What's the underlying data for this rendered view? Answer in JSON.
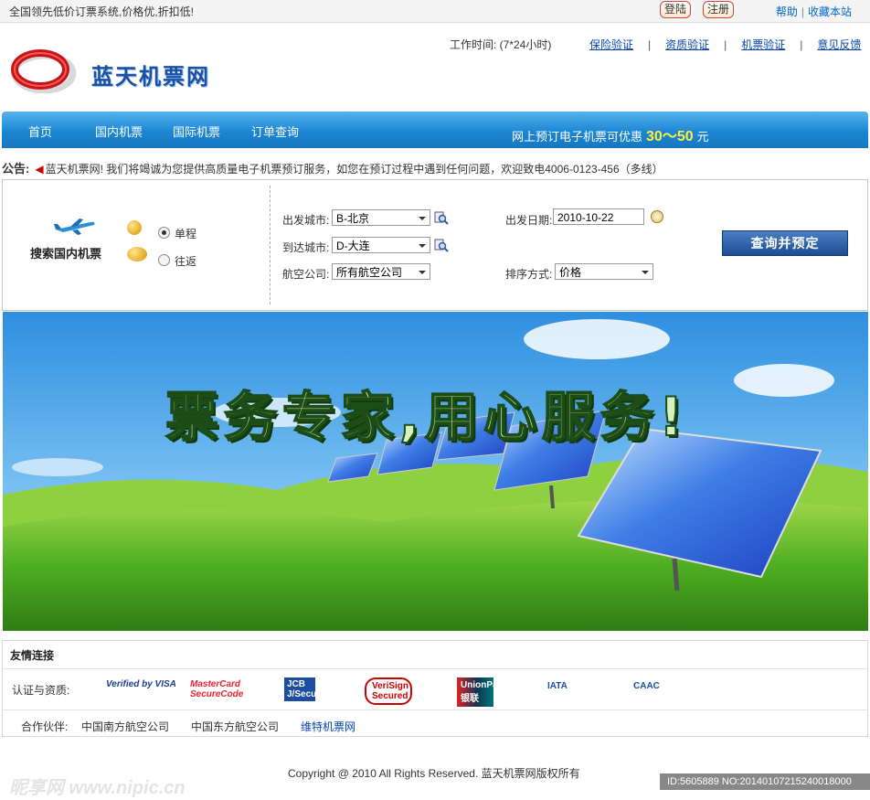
{
  "topbar": {
    "slogan": "全国领先低价订票系统,价格优,折扣低!",
    "login": "登陆",
    "register": "注册",
    "help": "帮助",
    "sep": "|",
    "favorite": "收藏本站"
  },
  "header": {
    "site_name": "蓝天机票网",
    "work_time": "工作时间: (7*24小时)",
    "links": [
      "保险验证",
      "资质验证",
      "机票验证",
      "意见反馈"
    ],
    "sep": "|"
  },
  "nav": {
    "items": [
      "首页",
      "国内机票",
      "国际机票",
      "订单查询"
    ],
    "promo_text": "网上预订电子机票可优惠",
    "promo_value": "30～50",
    "promo_unit": "元"
  },
  "notice": {
    "label": "公告:",
    "text": "蓝天机票网! 我们将竭诚为您提供高质量电子机票预订服务，如您在预订过程中遇到任何问题，欢迎致电4006-0123-456（多线）"
  },
  "search": {
    "title": "搜索国内机票",
    "trip_oneway": "单程",
    "trip_round": "往返",
    "depart_city_label": "出发城市:",
    "depart_city": "B-北京",
    "arrive_city_label": "到达城市:",
    "arrive_city": "D-大连",
    "airline_label": "航空公司:",
    "airline": "所有航空公司",
    "date_label": "出发日期:",
    "date": "2010-10-22",
    "sort_label": "排序方式:",
    "sort": "价格",
    "submit": "查询并预定"
  },
  "banner": {
    "slogan": "票务专家,用心服务!"
  },
  "links": {
    "header": "友情连接",
    "cert_label": "认证与资质:",
    "certs": [
      "Verified by VISA",
      "MasterCard SecureCode",
      "JCB J/Secure",
      "VeriSign Secured",
      "UnionPay 银联",
      "IATA",
      "CAAC"
    ],
    "partner_label": "合作伙伴:",
    "partners": [
      "中国南方航空公司",
      "中国东方航空公司",
      "维特机票网"
    ]
  },
  "footer": {
    "copyright": "Copyright @ 2010 All Rights Reserved. 蓝天机票网版权所有",
    "watermark": "昵享网 www.nipic.cn",
    "id_tag": "ID:5605889 NO:20140107215240018000"
  }
}
